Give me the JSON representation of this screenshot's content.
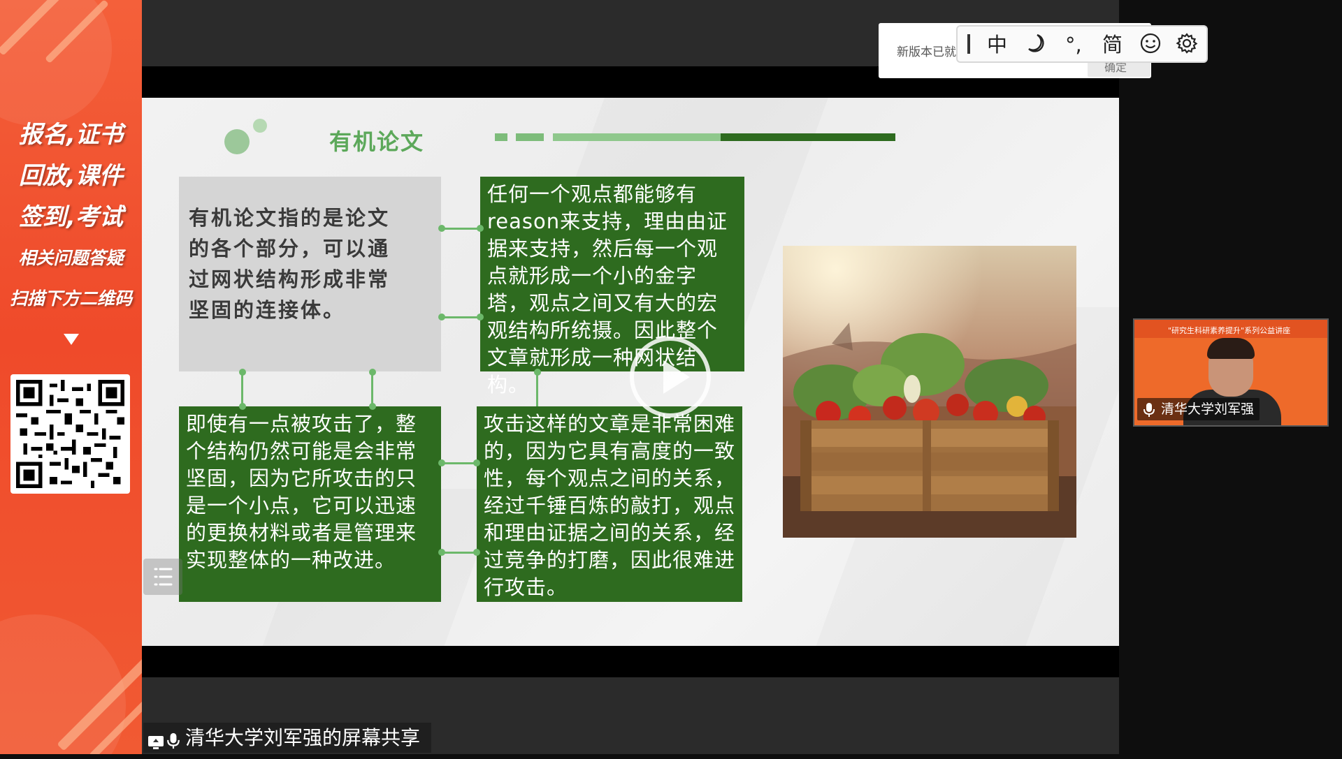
{
  "banner": {
    "line1": "报名,证书",
    "line2": "回放,课件",
    "line3": "签到,考试",
    "line4": "相关问题答疑",
    "line5": "扫描下方二维码"
  },
  "slide": {
    "title": "有机论文",
    "definition": "有机论文指的是论文的各个部分，可以通过网状结构形成非常坚固的连接体。",
    "box_top_right": "任何一个观点都能够有reason来支持，理由由证据来支持，然后每一个观点就形成一个小的金字塔，观点之间又有大的宏观结构所统摄。因此整个文章就形成一种网状结构。",
    "box_bottom_left": "即使有一点被攻击了，整个结构仍然可能是会非常坚固，因为它所攻击的只是一个小点，它可以迅速的更换材料或者是管理来实现整体的一种改进。",
    "box_bottom_right": "攻击这样的文章是非常困难的，因为它具有高度的一致性，每个观点之间的关系，经过千锤百炼的敲打，观点和理由证据之间的关系，经过竞争的打磨，因此很难进行攻击。"
  },
  "toast": {
    "text": "新版本已就",
    "confirm": "确定"
  },
  "ime": {
    "mode": "中",
    "punct": "°,",
    "script": "简"
  },
  "video": {
    "header": "\"研究生科研素养提升\"系列公益讲座",
    "participant": "清华大学刘军强"
  },
  "share_label": "清华大学刘军强的屏幕共享",
  "colors": {
    "banner": "#ef4a2a",
    "slide_green": "#2e6b1f",
    "accent_green": "#5ca85a"
  }
}
